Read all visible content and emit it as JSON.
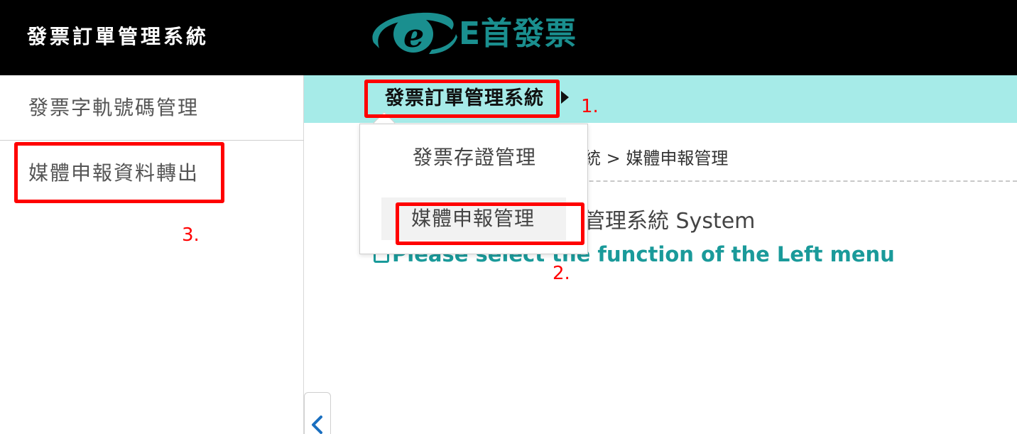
{
  "header": {
    "app_title": "發票訂單管理系統",
    "logo_text": "E首發票",
    "logo_mark": "e",
    "logo_icon": "e-logo-swoosh",
    "brand_color": "#1a8f8f"
  },
  "sidebar": {
    "items": [
      {
        "label": "發票字軌號碼管理"
      },
      {
        "label": "媒體申報資料轉出"
      }
    ],
    "collapse_icon": "chevron-left-icon"
  },
  "breadcrumb_bar": {
    "title": "發票訂單管理系統",
    "background_color": "#a6ebe8"
  },
  "dropdown": {
    "items": [
      {
        "label": "發票存證管理"
      },
      {
        "label": "媒體申報管理"
      }
    ]
  },
  "main": {
    "path_text": "統 > 媒體申報管理",
    "welcome_text": "管理系統 System",
    "hint_text": "Please select the function of the Left menu",
    "accent_color": "#1a9a9a"
  },
  "annotations": {
    "color": "#ff0000",
    "steps": [
      "1.",
      "2.",
      "3."
    ]
  }
}
